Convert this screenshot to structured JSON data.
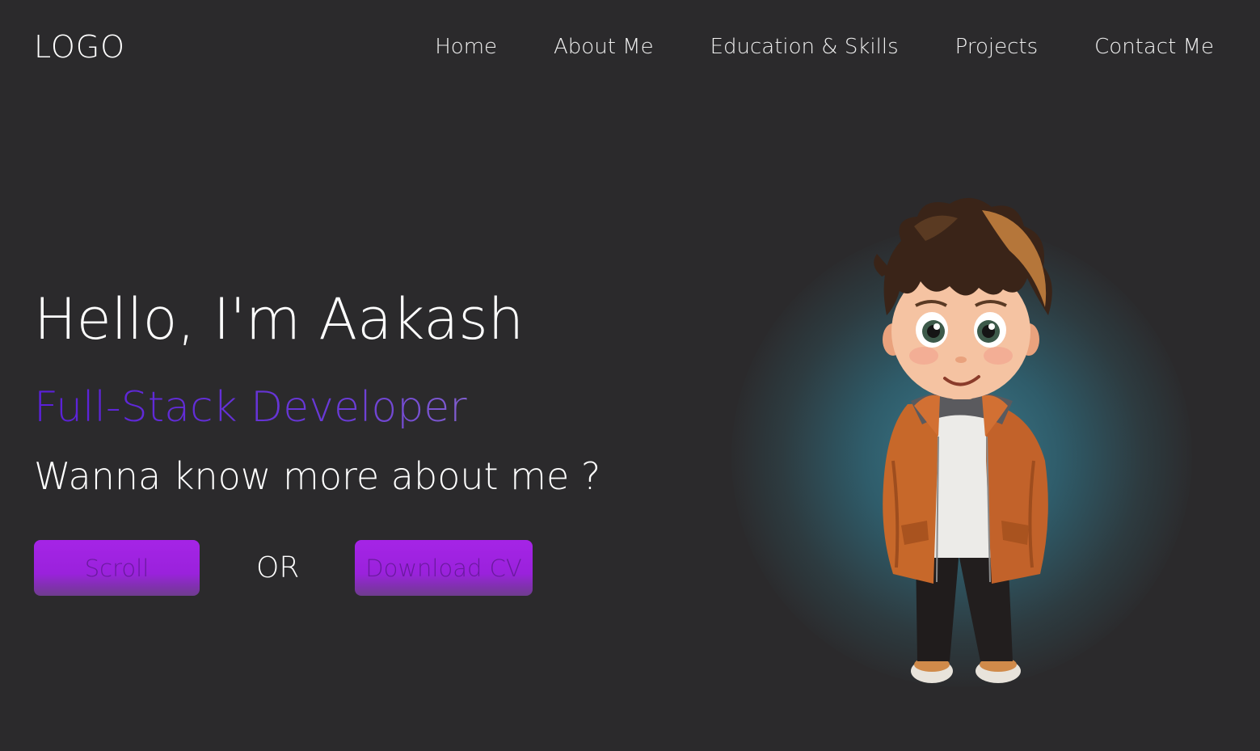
{
  "navbar": {
    "logo": "LOGO",
    "links": [
      "Home",
      "About Me",
      "Education & Skills",
      "Projects",
      "Contact Me"
    ]
  },
  "hero": {
    "greeting": "Hello, I'm Aakash",
    "role": "Full-Stack Developer",
    "prompt": "Wanna know more about me ?",
    "scroll_label": "Scroll",
    "or_label": "OR",
    "download_label": "Download CV"
  },
  "colors": {
    "background": "#2b2a2c",
    "accent": "#a524e6",
    "role_gradient_start": "#5a1fd8",
    "role_gradient_end": "#9a86c8"
  },
  "icons": {
    "avatar": "cartoon-boy-avatar"
  }
}
